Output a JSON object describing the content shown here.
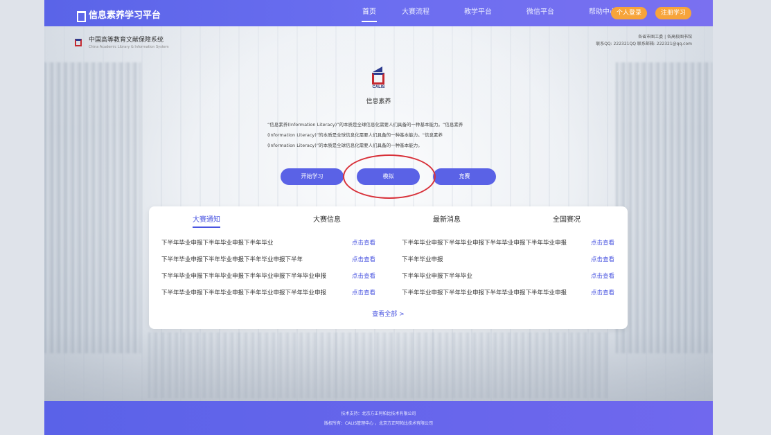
{
  "header": {
    "brand": "信息素养学习平台",
    "nav": [
      {
        "label": "首页",
        "active": true
      },
      {
        "label": "大赛流程",
        "active": false
      },
      {
        "label": "教学平台",
        "active": false
      },
      {
        "label": "微信平台",
        "active": false
      },
      {
        "label": "帮助中心",
        "active": false
      }
    ],
    "login_btn": "个人登录",
    "register_btn": "注册学习"
  },
  "subheader": {
    "org_cn": "中国高等教育文献保障系统",
    "org_en": "China Academic Library & Information System",
    "right_line1": "各省市图工委 | 各高校图书馆",
    "right_line2": "联系QQ: 222321QQ  联系邮箱: 222321@qq.com"
  },
  "hero": {
    "logo_text": "CALIS",
    "title": "信息素养",
    "intro": [
      "“信息素养(Information Literacy)”的本质是全球信息化需要人们具备的一种基本能力。“信息素养",
      "(Information Literacy)”的本质是全球信息化需要人们具备的一种基本能力。“信息素养",
      "(Information Literacy)”的本质是全球信息化需要人们具备的一种基本能力。"
    ],
    "buttons": [
      "开始学习",
      "模拟",
      "竞赛"
    ]
  },
  "panel": {
    "tabs": [
      {
        "label": "大赛通知",
        "active": true
      },
      {
        "label": "大赛信息",
        "active": false
      },
      {
        "label": "最新消息",
        "active": false
      },
      {
        "label": "全国赛况",
        "active": false
      }
    ],
    "left_items": [
      "下半年毕业申报下半年毕业申报下半年毕业",
      "下半年毕业申报下半年毕业申报下半年毕业申报下半年",
      "下半年毕业申报下半年毕业申报下半年毕业申报下半年毕业申报",
      "下半年毕业申报下半年毕业申报下半年毕业申报下半年毕业申报"
    ],
    "right_items": [
      "下半年毕业申报下半年毕业申报下半年毕业申报下半年毕业申报",
      "下半年毕业申报",
      "下半年毕业申报下半年毕业",
      "下半年毕业申报下半年毕业申报下半年毕业申报下半年毕业申报"
    ],
    "link_label": "点击查看",
    "view_all": "查看全部 >"
  },
  "footer": {
    "line1": "技术支持：北京方正阿帕比技术有限公司",
    "line2": "版权所有：CALIS管理中心 ，北京方正阿帕比技术有限公司"
  },
  "colors": {
    "primary": "#5a62e6",
    "accent": "#f7a43a",
    "highlight_circle": "#d8313a"
  }
}
